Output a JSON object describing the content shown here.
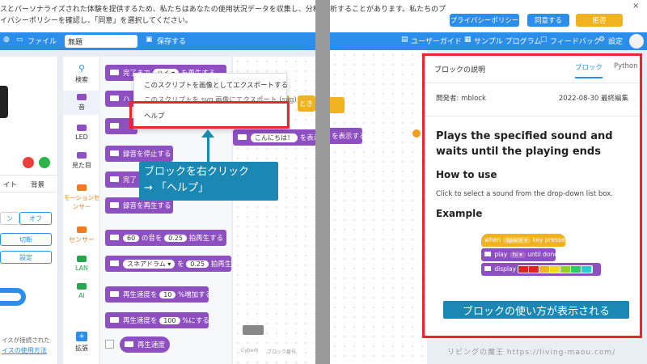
{
  "left_panel": {
    "banner_line1": "スとパーソナライズされた体験を提供するため、私たちはあなたの使用状況データを収集し、分析することがあ",
    "banner_line2": "イバシーポリシーを確認し、「同意」を選択してください。",
    "menu": {
      "file": "ファイル",
      "title_value": "無題",
      "save": "保存する"
    },
    "categories": [
      {
        "label": "検索",
        "color": "#2b8eea"
      },
      {
        "label": "音",
        "color": "#8e4fc1"
      },
      {
        "label": "LED",
        "color": "#8e4fc1"
      },
      {
        "label": "見た目",
        "color": "#8e4fc1"
      },
      {
        "label": "モーションセンサー",
        "color": "#f07b1e"
      },
      {
        "label": "センサー",
        "color": "#f07b1e"
      },
      {
        "label": "LAN",
        "color": "#2aa44f"
      },
      {
        "label": "AI",
        "color": "#2aa44f"
      },
      {
        "label": "拡張",
        "color": "#2b8eea"
      }
    ],
    "stage": {
      "tab_left": "イト",
      "tab_right": "背景",
      "toggle_off": "オフ",
      "toggle_on": "ン",
      "disconnect": "切断",
      "settings": "設定",
      "device_text_1": "イスが接続された",
      "device_text_2": "イスの使用方法"
    },
    "blocks": [
      {
        "text": "完了まで",
        "pill": "ハイ ▾",
        "suffix": "を再生する"
      },
      {
        "text": "ハ"
      },
      {
        "text": ""
      },
      {
        "text": "録音を停止する"
      },
      {
        "text": "完了"
      },
      {
        "text": "録音を再生する"
      },
      {
        "text": "",
        "pill": "60",
        "mid": "の音を",
        "pill2": "0.25",
        "suffix": "拍再生する"
      },
      {
        "text": "",
        "pill": "スネアドラム ▾",
        "mid": "を",
        "pill2": "0.25",
        "suffix": "拍再生"
      },
      {
        "text": "再生速度を",
        "pill": "10",
        "suffix": "%増加する"
      },
      {
        "text": "再生速度を",
        "pill": "100",
        "suffix": "%にする"
      },
      {
        "text": "再生速度"
      }
    ],
    "context_menu": {
      "item1": "このスクリプトを画像としてエクスポートする",
      "item2": "このスクリプトを svg 画像にエクスポート (svg)",
      "item3": "ヘルプ"
    },
    "canvas_block_left": "とき",
    "canvas_block_right": "とき",
    "canvas_say": "こんにちは！",
    "canvas_say_suffix": "を表示",
    "canvas_footer_left": "Cyberh",
    "canvas_footer_right": "ブロック番号",
    "callout_line1": "ブロックを右クリック",
    "callout_line2": "→ 「ヘルプ」"
  },
  "right_panel": {
    "banner_text1": "",
    "banner_line1": "析することがあります。私たちのプ",
    "privacy_btn": "プライバシーポリシー",
    "agree_btn": "同意する",
    "reject_btn": "拒否",
    "nav": {
      "user_guide": "ユーザーガイド",
      "sample_program": "サンプル プログラム",
      "feedback": "フィードバック",
      "settings": "設定"
    },
    "canvas_say_suffix": "を表示する",
    "help": {
      "title": "ブロックの説明",
      "tab_block": "ブロック",
      "tab_python": "Python",
      "developer": "開発者: mblock",
      "date": "2022-08-30 最終編集",
      "heading": "Plays the specified sound and waits until the playing ends",
      "how_to_use": "How to use",
      "how_to_text": "Click to select a sound from the drop-down list box.",
      "example": "Example",
      "ex_when": "when",
      "ex_key": "space ▾",
      "ex_key_pressed": "key pressed",
      "ex_play": "play",
      "ex_sound": "hi ▾",
      "ex_until": "until done",
      "ex_display": "display",
      "ex_colors": [
        "#e02424",
        "#e02424",
        "#f0b21e",
        "#f0d81e",
        "#8fd12c",
        "#2ccb6a",
        "#2ccbd1"
      ]
    },
    "callout": "ブロックの使い方が表示される",
    "watermark": "リビングの魔王 https://living-maou.com/"
  }
}
